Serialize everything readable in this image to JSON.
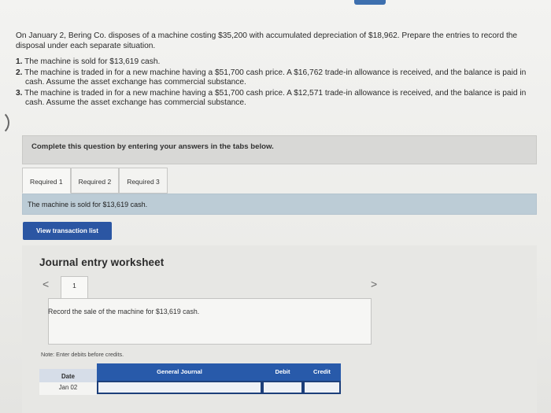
{
  "question": {
    "intro": "On January 2, Bering Co. disposes of a machine costing $35,200 with accumulated depreciation of $18,962. Prepare the entries to record the disposal under each separate situation.",
    "items": [
      {
        "num": "1.",
        "text": "The machine is sold for $13,619 cash."
      },
      {
        "num": "2.",
        "text": "The machine is traded in for a new machine having a $51,700 cash price. A $16,762 trade-in allowance is received, and the balance is paid in cash. Assume the asset exchange has commercial substance."
      },
      {
        "num": "3.",
        "text": "The machine is traded in for a new machine having a $51,700 cash price. A $12,571 trade-in allowance is received, and the balance is paid in cash. Assume the asset exchange has commercial substance."
      }
    ]
  },
  "instruction": "Complete this question by entering your answers in the tabs below.",
  "tabs": [
    "Required 1",
    "Required 2",
    "Required 3"
  ],
  "tab_panel_text": "The machine is sold for $13,619 cash.",
  "view_button": "View transaction list",
  "worksheet": {
    "title": "Journal entry worksheet",
    "nav_prev": "<",
    "nav_next": ">",
    "entry_number": "1",
    "entry_description": "Record the sale of the machine for $13,619 cash.",
    "note": "Note: Enter debits before credits.",
    "columns": {
      "date": "Date",
      "journal": "General Journal",
      "debit": "Debit",
      "credit": "Credit"
    },
    "row": {
      "date": "Jan 02"
    }
  },
  "colors": {
    "button_blue": "#2b56a3",
    "header_blue": "#285aaa",
    "tab_panel": "#bcccd6"
  }
}
